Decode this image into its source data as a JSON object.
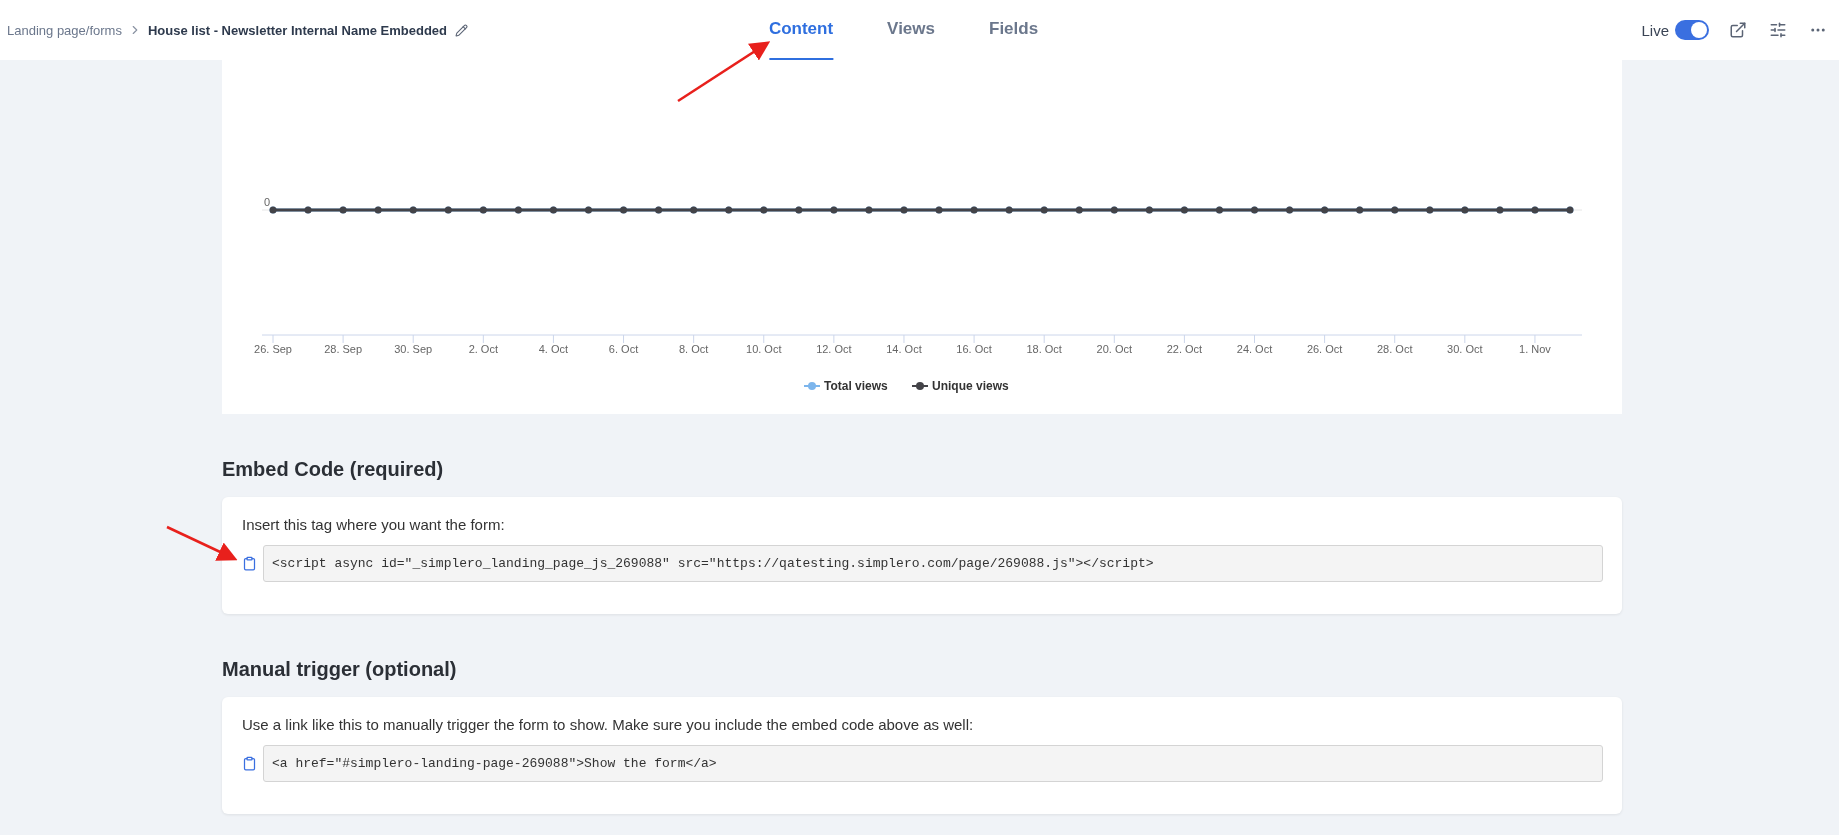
{
  "breadcrumb": {
    "parent": "Landing page/forms",
    "current": "House list - Newsletter Internal Name Embedded"
  },
  "tabs": [
    {
      "label": "Content",
      "selected": true
    },
    {
      "label": "Views",
      "selected": false
    },
    {
      "label": "Fields",
      "selected": false
    }
  ],
  "live": {
    "label": "Live",
    "on": true
  },
  "chart": {
    "y_axis_label": "0",
    "x_labels": [
      "26. Sep",
      "28. Sep",
      "30. Sep",
      "2. Oct",
      "4. Oct",
      "6. Oct",
      "8. Oct",
      "10. Oct",
      "12. Oct",
      "14. Oct",
      "16. Oct",
      "18. Oct",
      "20. Oct",
      "22. Oct",
      "24. Oct",
      "26. Oct",
      "28. Oct",
      "30. Oct",
      "1. Nov"
    ],
    "legend": [
      {
        "name": "Total views",
        "color": "#7cb5ec"
      },
      {
        "name": "Unique views",
        "color": "#434348"
      }
    ]
  },
  "sections": [
    {
      "title": "Embed Code (required)",
      "instruction": "Insert this tag where you want the form:",
      "code": "<script async id=\"_simplero_landing_page_js_269088\" src=\"https://qatesting.simplero.com/page/269088.js\"></script>"
    },
    {
      "title": "Manual trigger (optional)",
      "instruction": "Use a link like this to manually trigger the form to show. Make sure you include the embed code above as well:",
      "code": "<a href=\"#simplero-landing-page-269088\">Show the form</a>"
    }
  ]
}
